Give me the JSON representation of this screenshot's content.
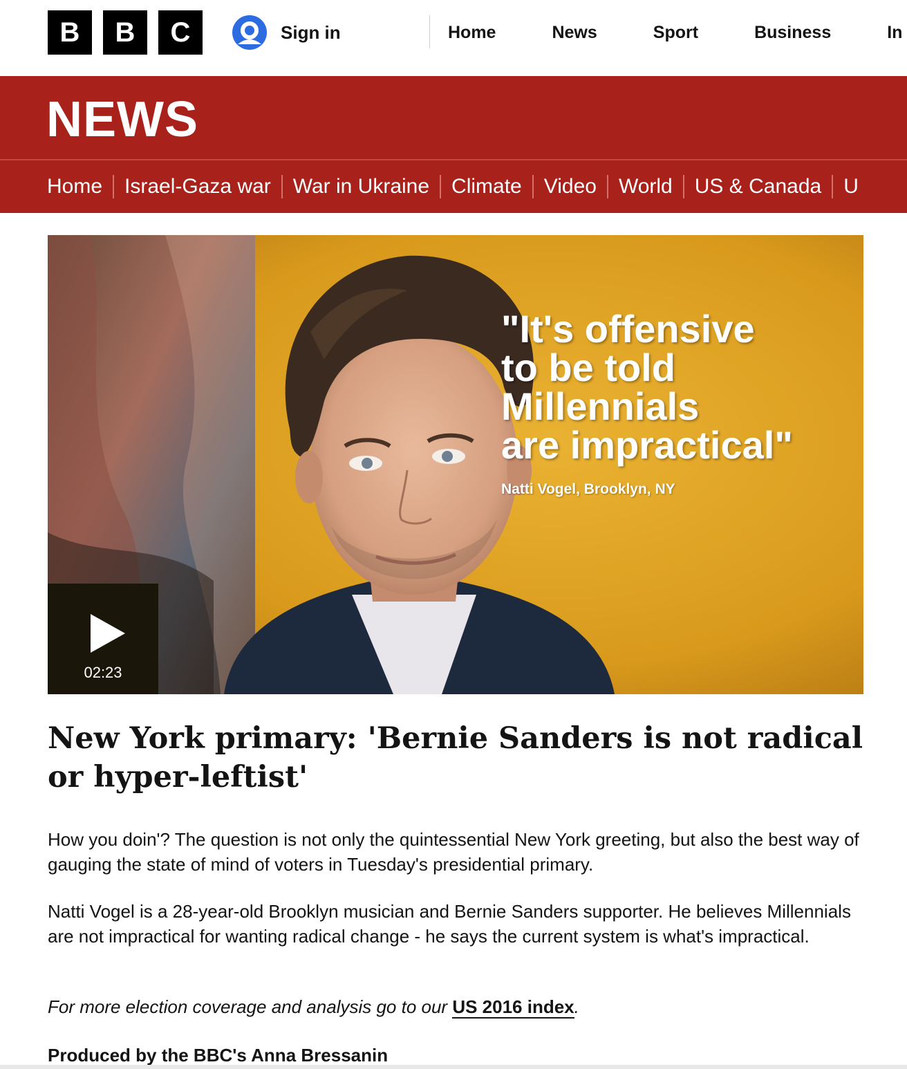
{
  "brand": {
    "letters": [
      "B",
      "B",
      "C"
    ],
    "signin_label": "Sign in"
  },
  "topnav": {
    "items": [
      "Home",
      "News",
      "Sport",
      "Business",
      "In"
    ]
  },
  "banner": {
    "title": "NEWS",
    "color": "#a8211a"
  },
  "subnav": {
    "items": [
      "Home",
      "Israel-Gaza war",
      "War in Ukraine",
      "Climate",
      "Video",
      "World",
      "US & Canada",
      "U"
    ]
  },
  "video": {
    "quote": "\"It's offensive\nto be told\nMillennials\nare impractical\"",
    "attribution": "Natti Vogel, Brooklyn, NY",
    "duration": "02:23",
    "background_color": "#e3a21e"
  },
  "article": {
    "headline": "New York primary: 'Bernie Sanders is not radical or hyper-leftist'",
    "paragraph1": "How you doin'? The question is not only the quintessential New York greeting, but also the best way of gauging the state of mind of voters in Tuesday's presidential primary.",
    "paragraph2": "Natti Vogel is a 28-year-old Brooklyn musician and Bernie Sanders supporter. He believes Millennials are not impractical for wanting radical change - he says the current system is what's impractical.",
    "paragraph3_prefix": "For more election coverage and analysis go to our ",
    "paragraph3_link": "US 2016 index",
    "paragraph3_suffix": ".",
    "credit": "Produced by the BBC's Anna Bressanin"
  }
}
